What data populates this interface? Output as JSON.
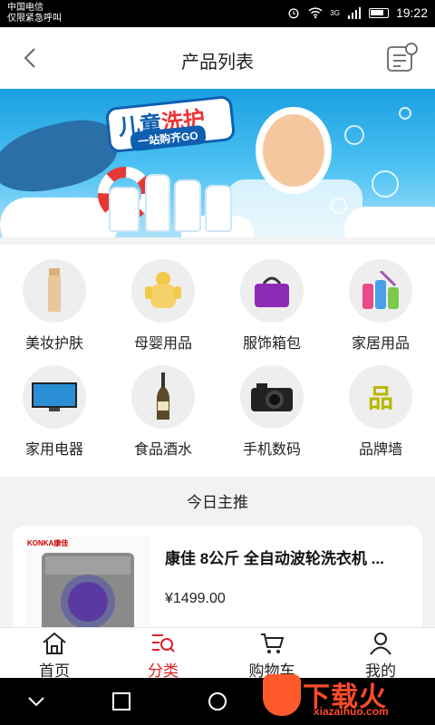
{
  "status_bar": {
    "carrier_line1": "中国电信",
    "carrier_line2": "仅限紧急呼叫",
    "network": "3G",
    "time": "19:22"
  },
  "header": {
    "title": "产品列表",
    "back_icon": "chevron-left-icon",
    "message_icon": "message-list-icon"
  },
  "banner": {
    "title_part1": "儿童",
    "title_part2": "洗护",
    "subtitle": "一站购齐GO"
  },
  "categories": [
    {
      "label": "美妆护肤",
      "icon": "cosmetics-icon"
    },
    {
      "label": "母婴用品",
      "icon": "baby-clothes-icon"
    },
    {
      "label": "服饰箱包",
      "icon": "handbag-icon"
    },
    {
      "label": "家居用品",
      "icon": "cleaning-supplies-icon"
    },
    {
      "label": "家用电器",
      "icon": "tv-icon"
    },
    {
      "label": "食品酒水",
      "icon": "wine-bottle-icon"
    },
    {
      "label": "手机数码",
      "icon": "camera-icon"
    },
    {
      "label": "品牌墙",
      "icon": "brand-wall-icon",
      "glyph": "品"
    }
  ],
  "featured": {
    "title": "今日主推",
    "products": [
      {
        "name": "康佳 8公斤 全自动波轮洗衣机 ...",
        "price": "¥1499.00",
        "brand": "KONKA康佳"
      }
    ]
  },
  "tab_bar": {
    "tabs": [
      {
        "label": "首页",
        "icon": "home-icon",
        "active": false
      },
      {
        "label": "分类",
        "icon": "category-icon",
        "active": true
      },
      {
        "label": "购物车",
        "icon": "cart-icon",
        "active": false
      },
      {
        "label": "我的",
        "icon": "user-icon",
        "active": false
      }
    ]
  },
  "watermark": {
    "text": "下载火",
    "url": "xiazaihuo.com"
  },
  "colors": {
    "accent": "#e02020",
    "brand_wall_icon": "#b7b800",
    "watermark": "#ff4b2b"
  }
}
